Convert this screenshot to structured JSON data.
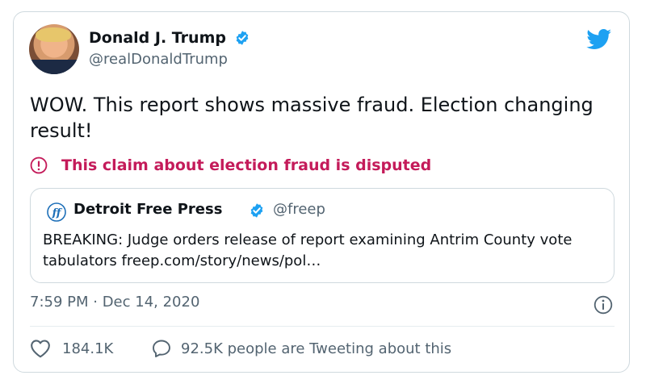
{
  "tweet": {
    "author": {
      "name": "Donald J. Trump",
      "handle": "@realDonaldTrump"
    },
    "text": "WOW. This report shows massive fraud. Election changing result!",
    "dispute_label": "This claim about election fraud is disputed",
    "quoted": {
      "name": "Detroit Free Press",
      "handle": "@freep",
      "text": "BREAKING: Judge orders release of report examining Antrim County vote tabulators freep.com/story/news/pol…"
    },
    "timestamp": "7:59 PM · Dec 14, 2020",
    "likes": "184.1K",
    "replies_label": "92.5K people are Tweeting about this"
  },
  "colors": {
    "brand": "#1da1f2",
    "dispute": "#c41b5a",
    "secondary_text": "#536471"
  },
  "icons": [
    "verified-icon",
    "twitter-bird-icon",
    "exclamation-circle-icon",
    "info-icon",
    "heart-icon",
    "comment-icon",
    "freep-logo-icon"
  ]
}
